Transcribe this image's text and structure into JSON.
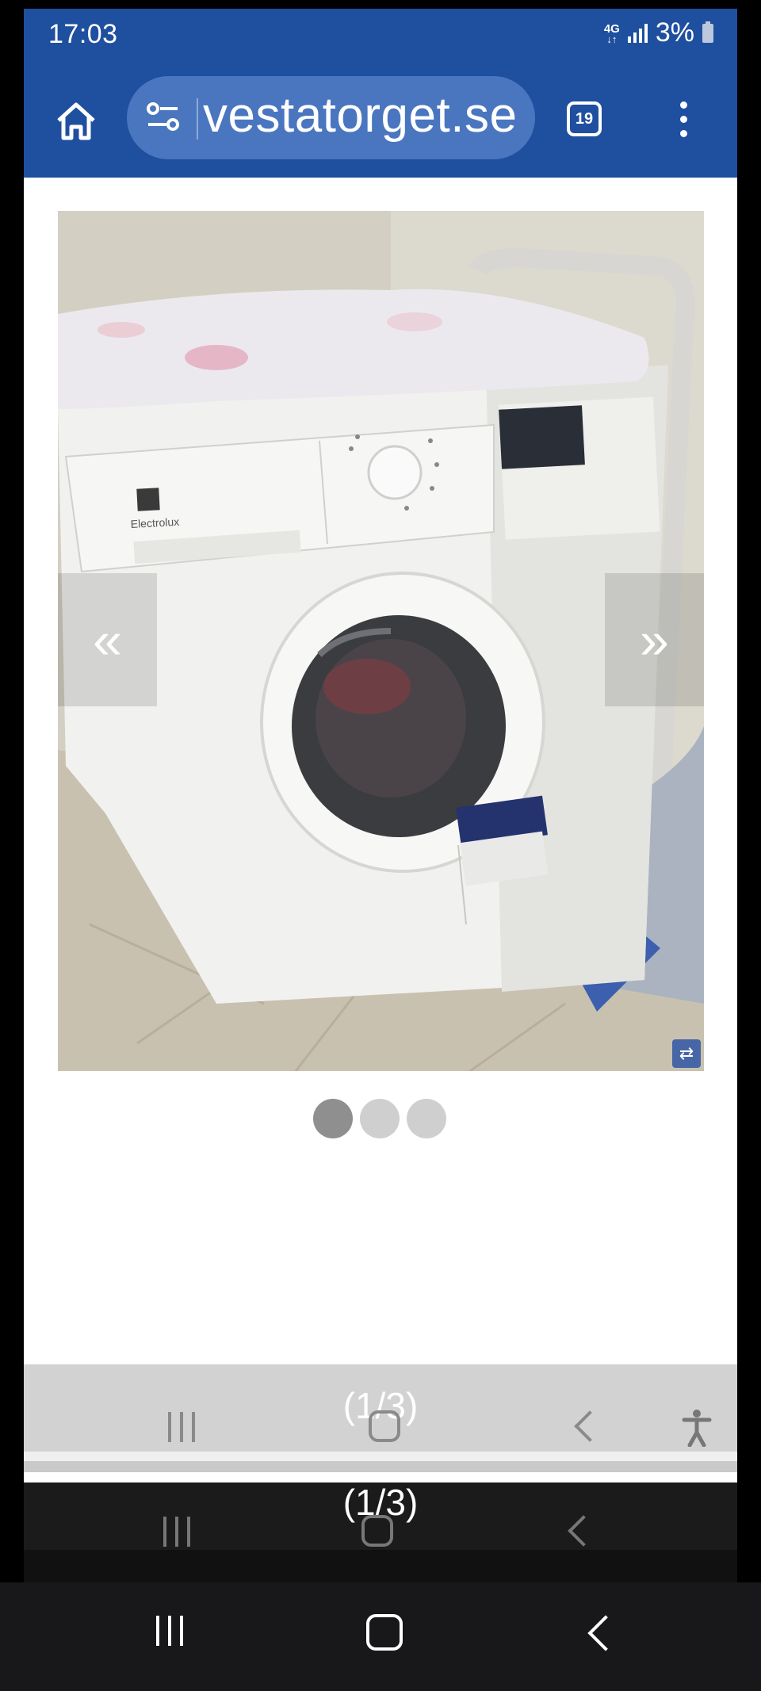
{
  "status_bar": {
    "time": "17:03",
    "network": "4G",
    "battery": "3%"
  },
  "browser": {
    "url": "vestatorget.se",
    "tab_count": "19",
    "icons": [
      "home-icon",
      "site-settings-icon",
      "tabs-icon",
      "more-icon"
    ]
  },
  "gallery": {
    "image_description_alt": "Electrolux washing machine",
    "brand_text": "Electrolux",
    "prev_glyph": "«",
    "next_glyph": "»",
    "current_index": 1,
    "total": 3,
    "counter": "(1/3)"
  },
  "colors": {
    "toolbar": "#1f4f9f",
    "url_pill": "#4a76bf",
    "dot_active": "#8f8f8f",
    "dot_inactive": "#cfcfcf"
  }
}
